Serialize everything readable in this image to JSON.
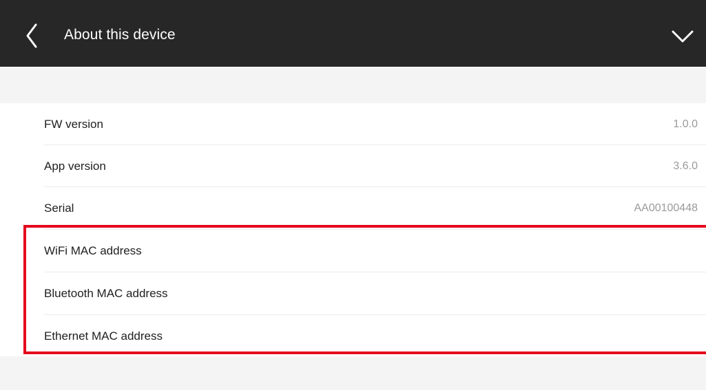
{
  "header": {
    "title": "About this device",
    "back_icon": "chevron-left-icon",
    "collapse_icon": "chevron-down-icon",
    "background": "#272727"
  },
  "rows": [
    {
      "label": "FW version",
      "value": "1.0.0"
    },
    {
      "label": "App version",
      "value": "3.6.0"
    },
    {
      "label": "Serial",
      "value": "AA00100448"
    },
    {
      "label": "WiFi MAC address",
      "value": ""
    },
    {
      "label": "Bluetooth MAC address",
      "value": ""
    },
    {
      "label": "Ethernet MAC address",
      "value": ""
    }
  ],
  "annotation": {
    "highlight_color": "#e4071c"
  }
}
